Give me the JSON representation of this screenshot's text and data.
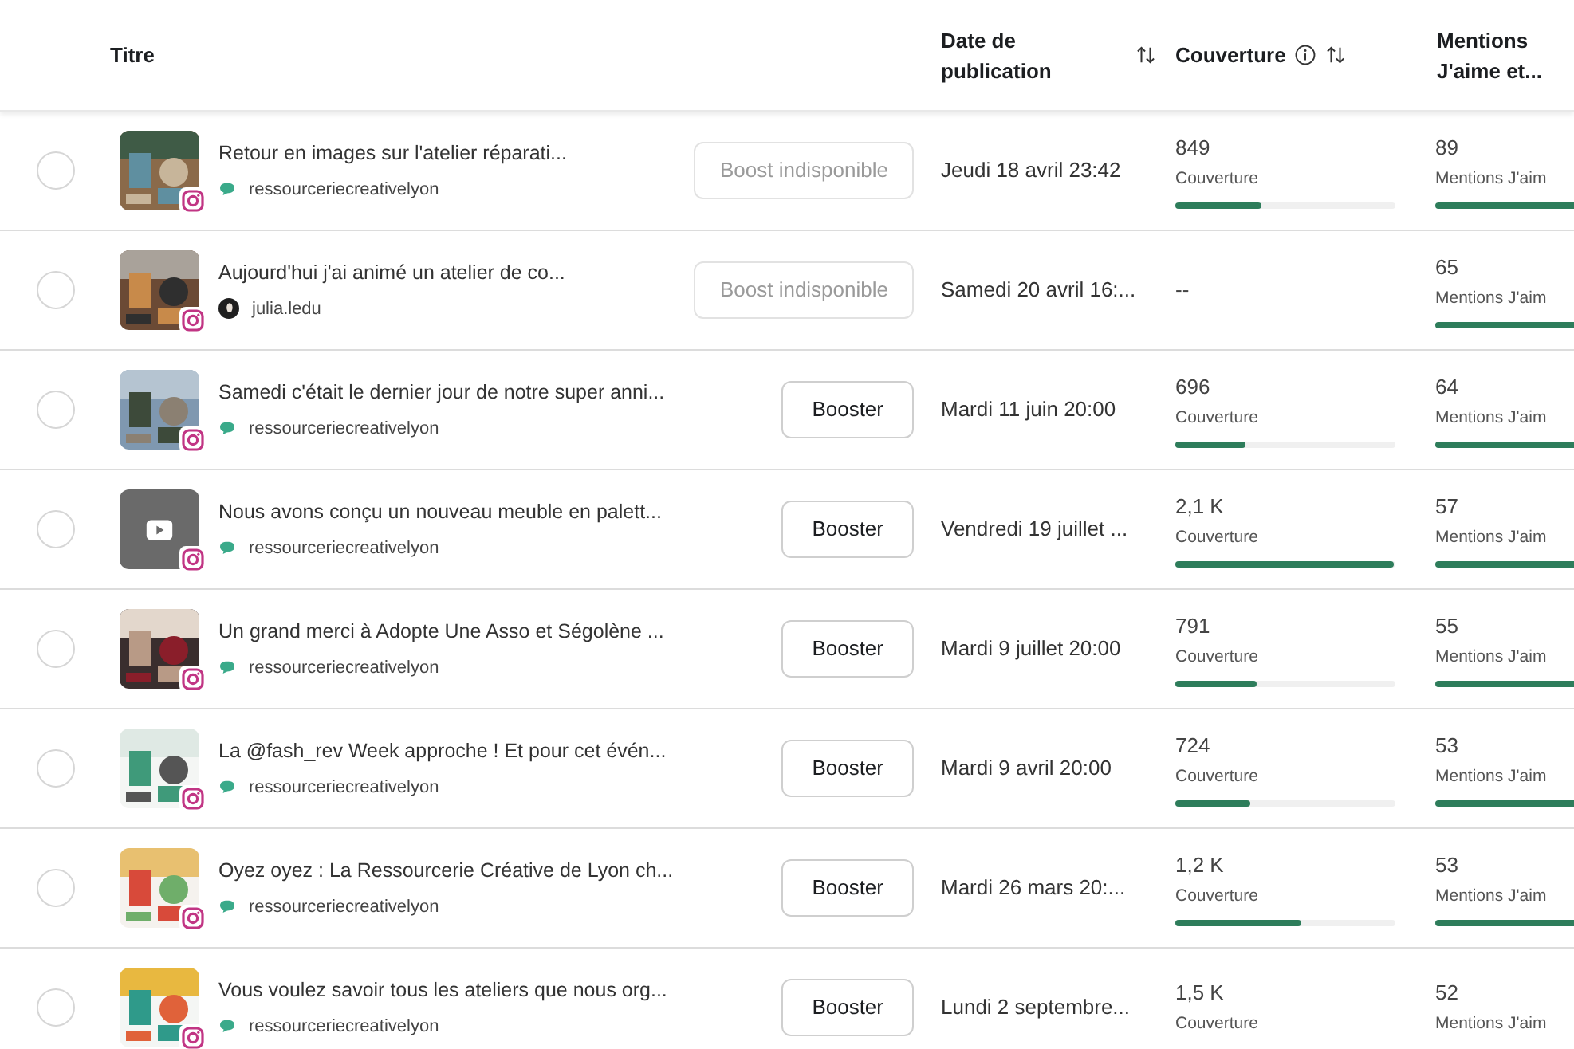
{
  "table": {
    "columns": [
      {
        "label": "Titre"
      },
      {
        "label": "Date de publication",
        "sortable": true
      },
      {
        "label": "Couverture",
        "info": true,
        "sortable": true
      },
      {
        "label": "Mentions J'aime et..."
      }
    ],
    "rows": [
      {
        "selected": false,
        "title": "Retour en images sur l'atelier réparati...",
        "account": {
          "kind": "page",
          "name": "ressourceriecreativelyon"
        },
        "boost": {
          "label": "Boost indisponible",
          "disabled": true
        },
        "date": "Jeudi 18 avril 23:42",
        "coverage": {
          "value": "849",
          "label": "Couverture",
          "level": 0.39
        },
        "likes": {
          "value": "89",
          "label": "Mentions J'aim"
        }
      },
      {
        "selected": false,
        "title": "Aujourd'hui j'ai animé un atelier de co...",
        "account": {
          "kind": "person",
          "name": "julia.ledu"
        },
        "boost": {
          "label": "Boost indisponible",
          "disabled": true
        },
        "date": "Samedi 20 avril 16:...",
        "coverage": {
          "value": "--"
        },
        "likes": {
          "value": "65",
          "label": "Mentions J'aim"
        }
      },
      {
        "selected": false,
        "title": "Samedi c'était le dernier jour de notre super anni...",
        "account": {
          "kind": "page",
          "name": "ressourceriecreativelyon"
        },
        "boost": {
          "label": "Booster",
          "disabled": false
        },
        "date": "Mardi 11 juin 20:00",
        "coverage": {
          "value": "696",
          "label": "Couverture",
          "level": 0.32
        },
        "likes": {
          "value": "64",
          "label": "Mentions J'aim"
        }
      },
      {
        "selected": false,
        "thumbnail": {
          "kind": "video"
        },
        "title": "Nous avons conçu un nouveau meuble en palett...",
        "account": {
          "kind": "page",
          "name": "ressourceriecreativelyon"
        },
        "boost": {
          "label": "Booster",
          "disabled": false
        },
        "date": "Vendredi 19 juillet ...",
        "coverage": {
          "value": "2,1 K",
          "label": "Couverture",
          "level": 0.99
        },
        "likes": {
          "value": "57",
          "label": "Mentions J'aim"
        }
      },
      {
        "selected": false,
        "title": "Un grand merci à Adopte Une Asso et Ségolène ...",
        "account": {
          "kind": "page",
          "name": "ressourceriecreativelyon"
        },
        "boost": {
          "label": "Booster",
          "disabled": false
        },
        "date": "Mardi 9 juillet 20:00",
        "coverage": {
          "value": "791",
          "label": "Couverture",
          "level": 0.37
        },
        "likes": {
          "value": "55",
          "label": "Mentions J'aim"
        }
      },
      {
        "selected": false,
        "title": "La @fash_rev Week approche ! Et pour cet évén...",
        "account": {
          "kind": "page",
          "name": "ressourceriecreativelyon"
        },
        "boost": {
          "label": "Booster",
          "disabled": false
        },
        "date": "Mardi 9 avril 20:00",
        "coverage": {
          "value": "724",
          "label": "Couverture",
          "level": 0.34
        },
        "likes": {
          "value": "53",
          "label": "Mentions J'aim"
        }
      },
      {
        "selected": false,
        "title": "Oyez oyez : La Ressourcerie Créative de Lyon ch...",
        "account": {
          "kind": "page",
          "name": "ressourceriecreativelyon"
        },
        "boost": {
          "label": "Booster",
          "disabled": false
        },
        "date": "Mardi 26 mars 20:...",
        "coverage": {
          "value": "1,2 K",
          "label": "Couverture",
          "level": 0.57
        },
        "likes": {
          "value": "53",
          "label": "Mentions J'aim"
        }
      },
      {
        "selected": false,
        "title": "Vous voulez savoir tous les ateliers que nous org...",
        "account": {
          "kind": "page",
          "name": "ressourceriecreativelyon"
        },
        "boost": {
          "label": "Booster",
          "disabled": false
        },
        "date": "Lundi 2 septembre...",
        "coverage": {
          "value": "1,5 K",
          "label": "Couverture"
        },
        "likes": {
          "value": "52",
          "label": "Mentions J'aim"
        }
      }
    ]
  }
}
